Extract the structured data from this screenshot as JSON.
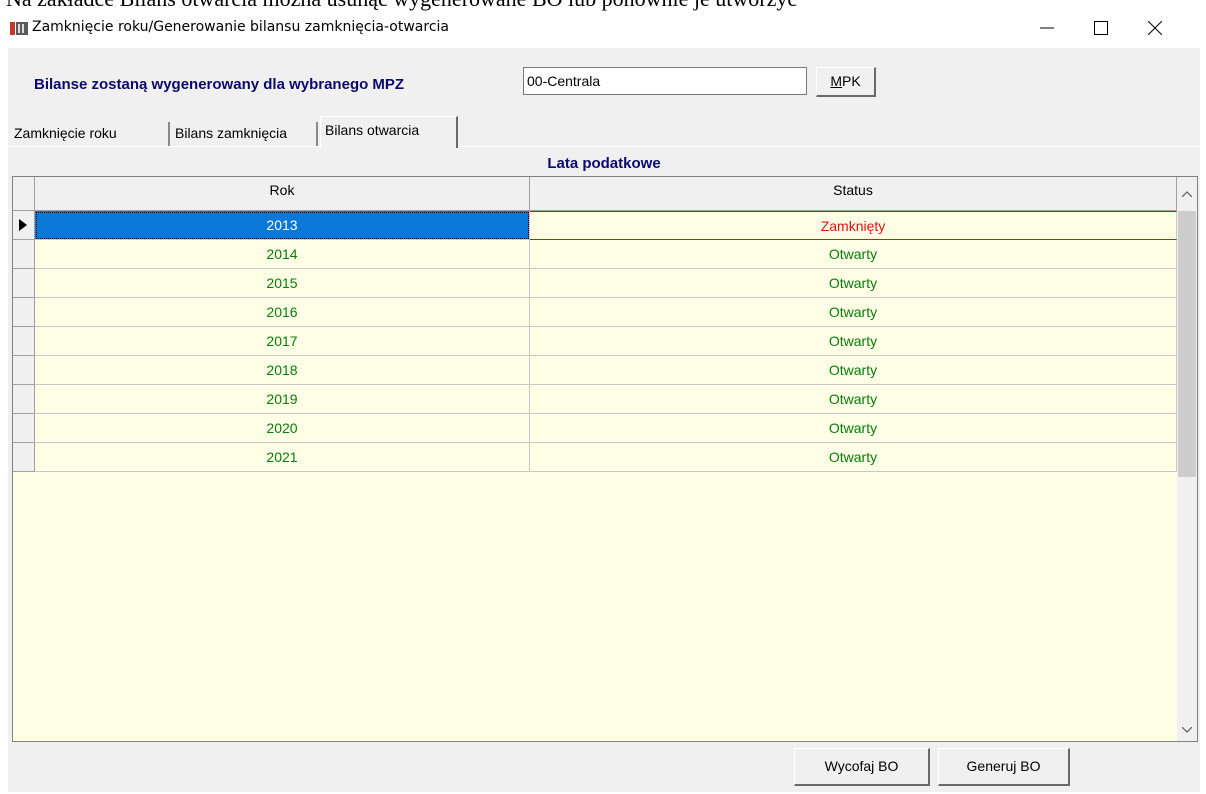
{
  "doc_background_text": "Na zakładce Bilans otwarcia można usunąć wygenerowane BO lub ponownie je utworzyć",
  "window": {
    "title": "Zamknięcie roku/Generowanie bilansu zamknięcia-otwarcia"
  },
  "mpz": {
    "label": "Bilanse zostaną wygenerowany dla wybranego MPZ",
    "value": "00-Centrala",
    "mpk_button_underlined": "M",
    "mpk_button_rest": "PK"
  },
  "tabs": [
    {
      "label": "Zamknięcie roku",
      "active": false
    },
    {
      "label": "Bilans zamknięcia",
      "active": false
    },
    {
      "label": "Bilans otwarcia",
      "active": true
    }
  ],
  "grid": {
    "title": "Lata podatkowe",
    "columns": [
      "Rok",
      "Status"
    ],
    "rows": [
      {
        "rok": "2013",
        "status": "Zamknięty",
        "selected": true
      },
      {
        "rok": "2014",
        "status": "Otwarty"
      },
      {
        "rok": "2015",
        "status": "Otwarty"
      },
      {
        "rok": "2016",
        "status": "Otwarty"
      },
      {
        "rok": "2017",
        "status": "Otwarty"
      },
      {
        "rok": "2018",
        "status": "Otwarty"
      },
      {
        "rok": "2019",
        "status": "Otwarty"
      },
      {
        "rok": "2020",
        "status": "Otwarty"
      },
      {
        "rok": "2021",
        "status": "Otwarty"
      }
    ]
  },
  "buttons": {
    "wycofaj": "Wycofaj BO",
    "generuj": "Generuj BO"
  },
  "colors": {
    "grid_background": "#ffffe6",
    "open_status": "#0a7a0a",
    "closed_status": "#e01010",
    "label_blue": "#0a0a6e",
    "selection": "#0a78d7"
  },
  "icons": {
    "app": "app-icon",
    "minimize": "minimize-icon",
    "maximize": "maximize-icon",
    "close": "close-icon"
  }
}
